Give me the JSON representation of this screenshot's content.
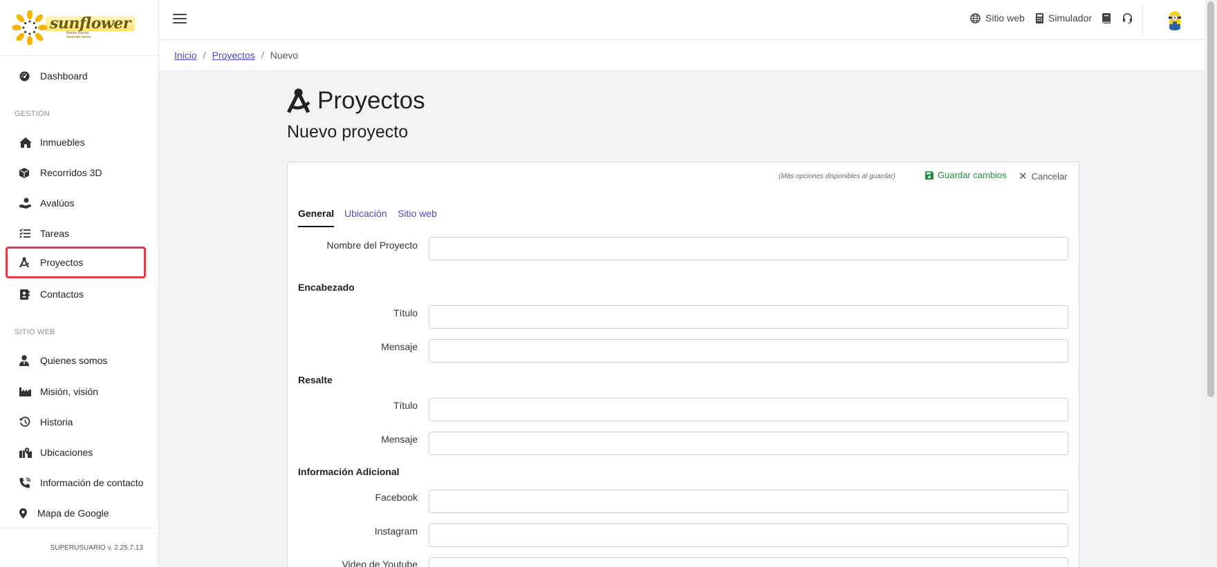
{
  "brand": {
    "logo_word": "sunflower",
    "logo_sub1": "Bienes Raíces",
    "logo_sub2": "haciendo raíces"
  },
  "sidebar": {
    "dashboard": "Dashboard",
    "section_gestion": "GESTIÓN",
    "items_gestion": [
      {
        "label": "Inmuebles",
        "icon": "home-icon"
      },
      {
        "label": "Recorridos 3D",
        "icon": "cube-icon"
      },
      {
        "label": "Avalúos",
        "icon": "hand-coin-icon"
      },
      {
        "label": "Tareas",
        "icon": "tasks-icon"
      },
      {
        "label": "Proyectos",
        "icon": "compass-drafting-icon",
        "active": true
      },
      {
        "label": "Contactos",
        "icon": "address-book-icon"
      }
    ],
    "section_sitio": "SITIO WEB",
    "items_sitio": [
      {
        "label": "Quienes somos",
        "icon": "user-tie-icon"
      },
      {
        "label": "Misión, visión",
        "icon": "industry-icon"
      },
      {
        "label": "Historia",
        "icon": "history-icon"
      },
      {
        "label": "Ubicaciones",
        "icon": "map-location-icon"
      },
      {
        "label": "Información de contacto",
        "icon": "phone-volume-icon"
      },
      {
        "label": "Mapa de Google",
        "icon": "map-pin-icon"
      }
    ],
    "footer": "SUPERUSUARIO v. 2.25.7.13"
  },
  "topbar": {
    "sitio_web": "Sitio web",
    "simulador": "Simulador"
  },
  "breadcrumb": {
    "inicio": "Inicio",
    "proyectos": "Proyectos",
    "current": "Nuevo"
  },
  "page": {
    "title": "Proyectos",
    "subtitle": "Nuevo proyecto"
  },
  "form": {
    "note": "(Más opciones disponibles al guardar)",
    "save_label": "Guardar cambios",
    "cancel_label": "Cancelar",
    "tabs": [
      "General",
      "Ubicación",
      "Sitio web"
    ],
    "nombre_label": "Nombre del Proyecto",
    "encabezado_heading": "Encabezado",
    "titulo_label": "Título",
    "mensaje_label": "Mensaje",
    "resalte_heading": "Resalte",
    "info_heading": "Información Adicional",
    "facebook_label": "Facebook",
    "instagram_label": "Instagram",
    "youtube_label": "Video de Youtube",
    "values": {
      "nombre": "",
      "enc_titulo": "",
      "enc_mensaje": "",
      "res_titulo": "",
      "res_mensaje": "",
      "facebook": "",
      "instagram": "",
      "youtube": ""
    }
  },
  "colors": {
    "accent_link": "#4b46c8",
    "save_green": "#1e8f3e",
    "active_border": "#e33b46"
  }
}
